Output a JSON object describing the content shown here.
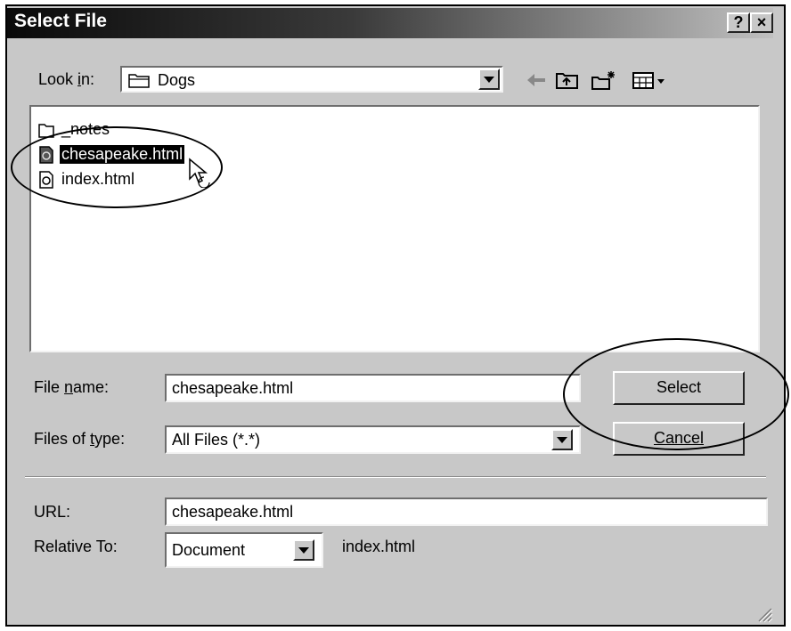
{
  "dialog": {
    "title": "Select File",
    "help_button": "?",
    "close_button": "×"
  },
  "look_in": {
    "label_pre": "Look ",
    "label_ul": "i",
    "label_post": "n:",
    "value": "Dogs"
  },
  "files": [
    {
      "name": "_notes",
      "icon": "folder-icon",
      "selected": false
    },
    {
      "name": "chesapeake.html",
      "icon": "html-file-icon",
      "selected": true
    },
    {
      "name": "index.html",
      "icon": "html-file-icon",
      "selected": false
    }
  ],
  "file_name": {
    "label_pre": "File ",
    "label_ul": "n",
    "label_post": "ame:",
    "value": "chesapeake.html"
  },
  "files_of_type": {
    "label_pre": "Files of ",
    "label_ul": "t",
    "label_post": "ype:",
    "value": "All Files (*.*)"
  },
  "buttons": {
    "select": "Select",
    "cancel": "Cancel"
  },
  "url": {
    "label": "URL:",
    "value": "chesapeake.html"
  },
  "relative_to": {
    "label": "Relative To:",
    "value": "Document",
    "target": "index.html"
  }
}
